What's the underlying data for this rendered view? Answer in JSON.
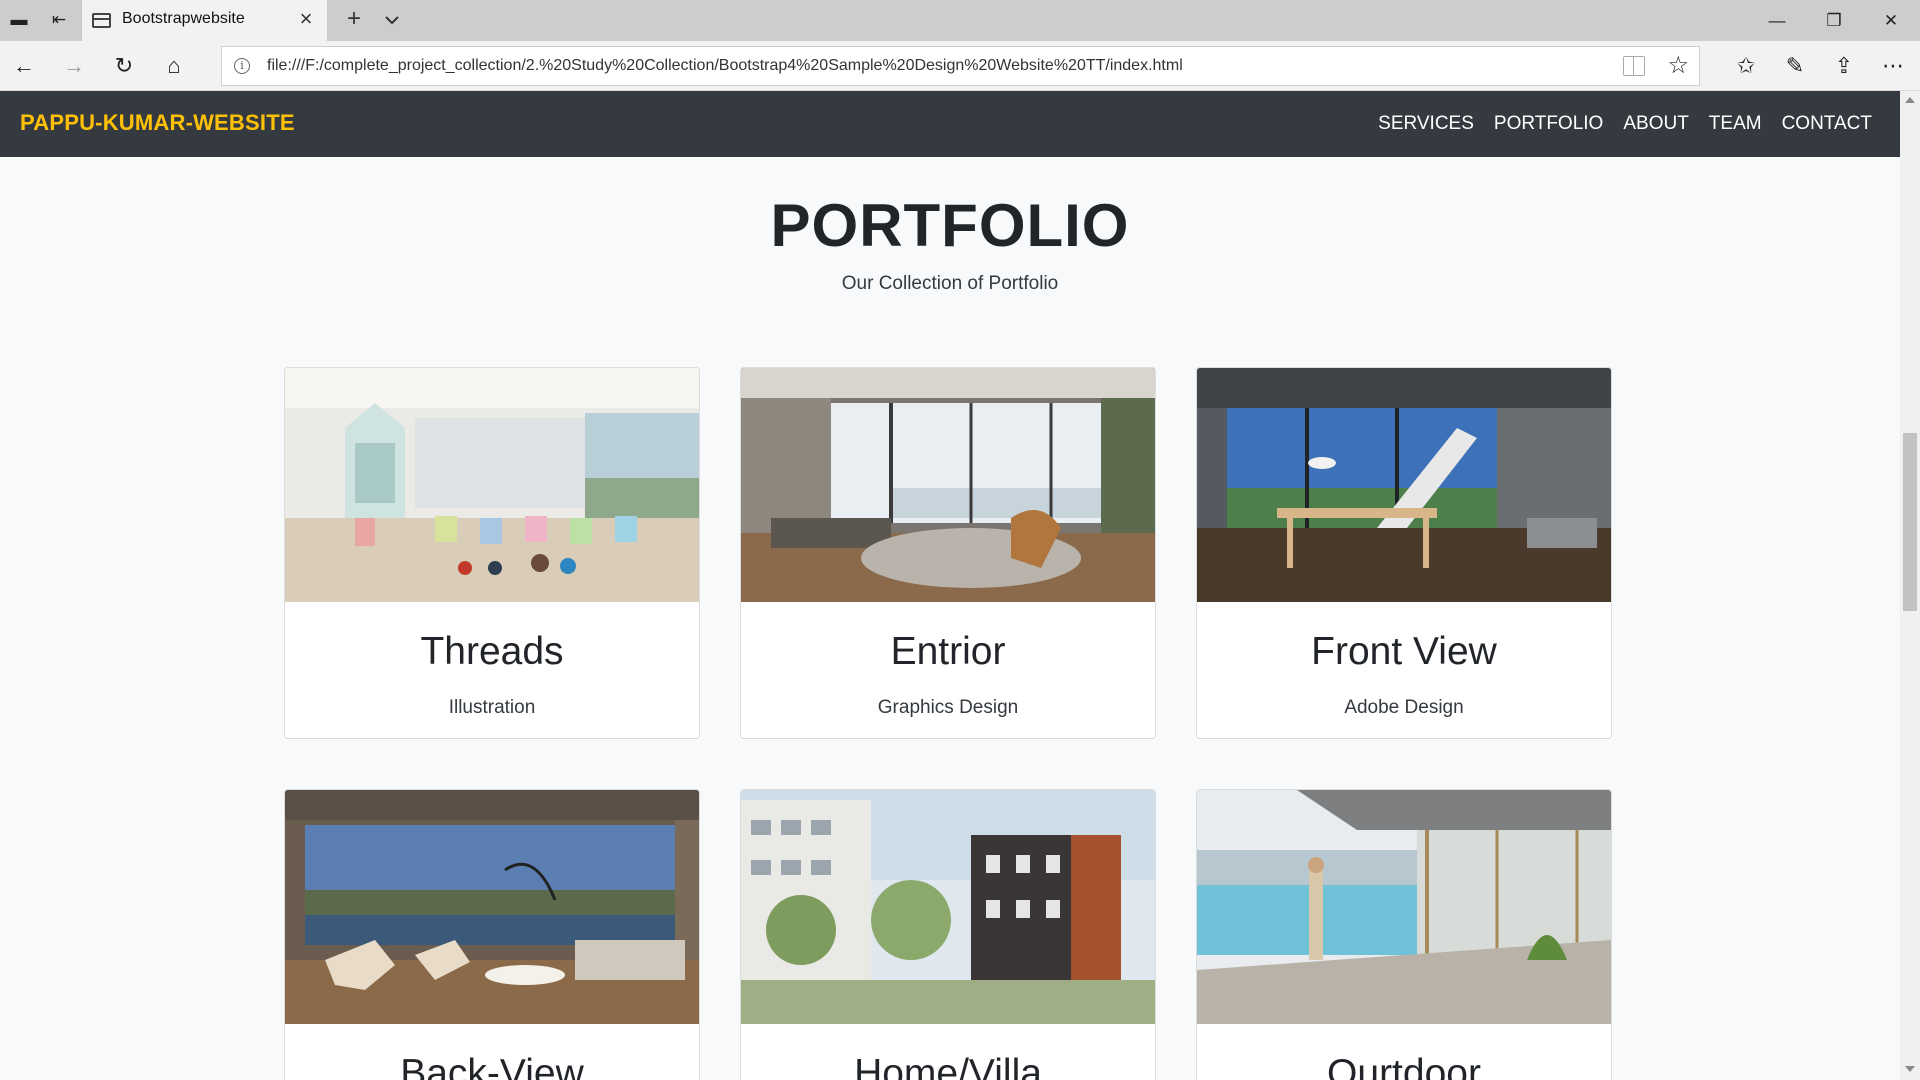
{
  "browser": {
    "tab_title": "Bootstrapwebsite",
    "url": "file:///F:/complete_project_collection/2.%20Study%20Collection/Bootstrap4%20Sample%20Design%20Website%20TT/index.html"
  },
  "navbar": {
    "brand": "PAPPU-KUMAR-WEBSITE",
    "brand_color": "#ffc107",
    "background": "#343a40",
    "items": [
      {
        "label": "SERVICES"
      },
      {
        "label": "PORTFOLIO"
      },
      {
        "label": "ABOUT"
      },
      {
        "label": "TEAM"
      },
      {
        "label": "CONTACT"
      }
    ]
  },
  "portfolio": {
    "heading": "PORTFOLIO",
    "subheading": "Our Collection of Portfolio",
    "cards": [
      {
        "title": "Threads",
        "subtitle": "Illustration",
        "image": "kindergarten-interior-photo"
      },
      {
        "title": "Entrior",
        "subtitle": "Graphics Design",
        "image": "living-room-interior-photo"
      },
      {
        "title": "Front View",
        "subtitle": "Adobe Design",
        "image": "dining-room-interior-photo"
      },
      {
        "title": "Back-View",
        "subtitle": "",
        "image": "lounge-lake-view-photo"
      },
      {
        "title": "Home/Villa",
        "subtitle": "",
        "image": "apartment-buildings-photo"
      },
      {
        "title": "Ourtdoor",
        "subtitle": "",
        "image": "balcony-lake-view-photo"
      }
    ]
  }
}
